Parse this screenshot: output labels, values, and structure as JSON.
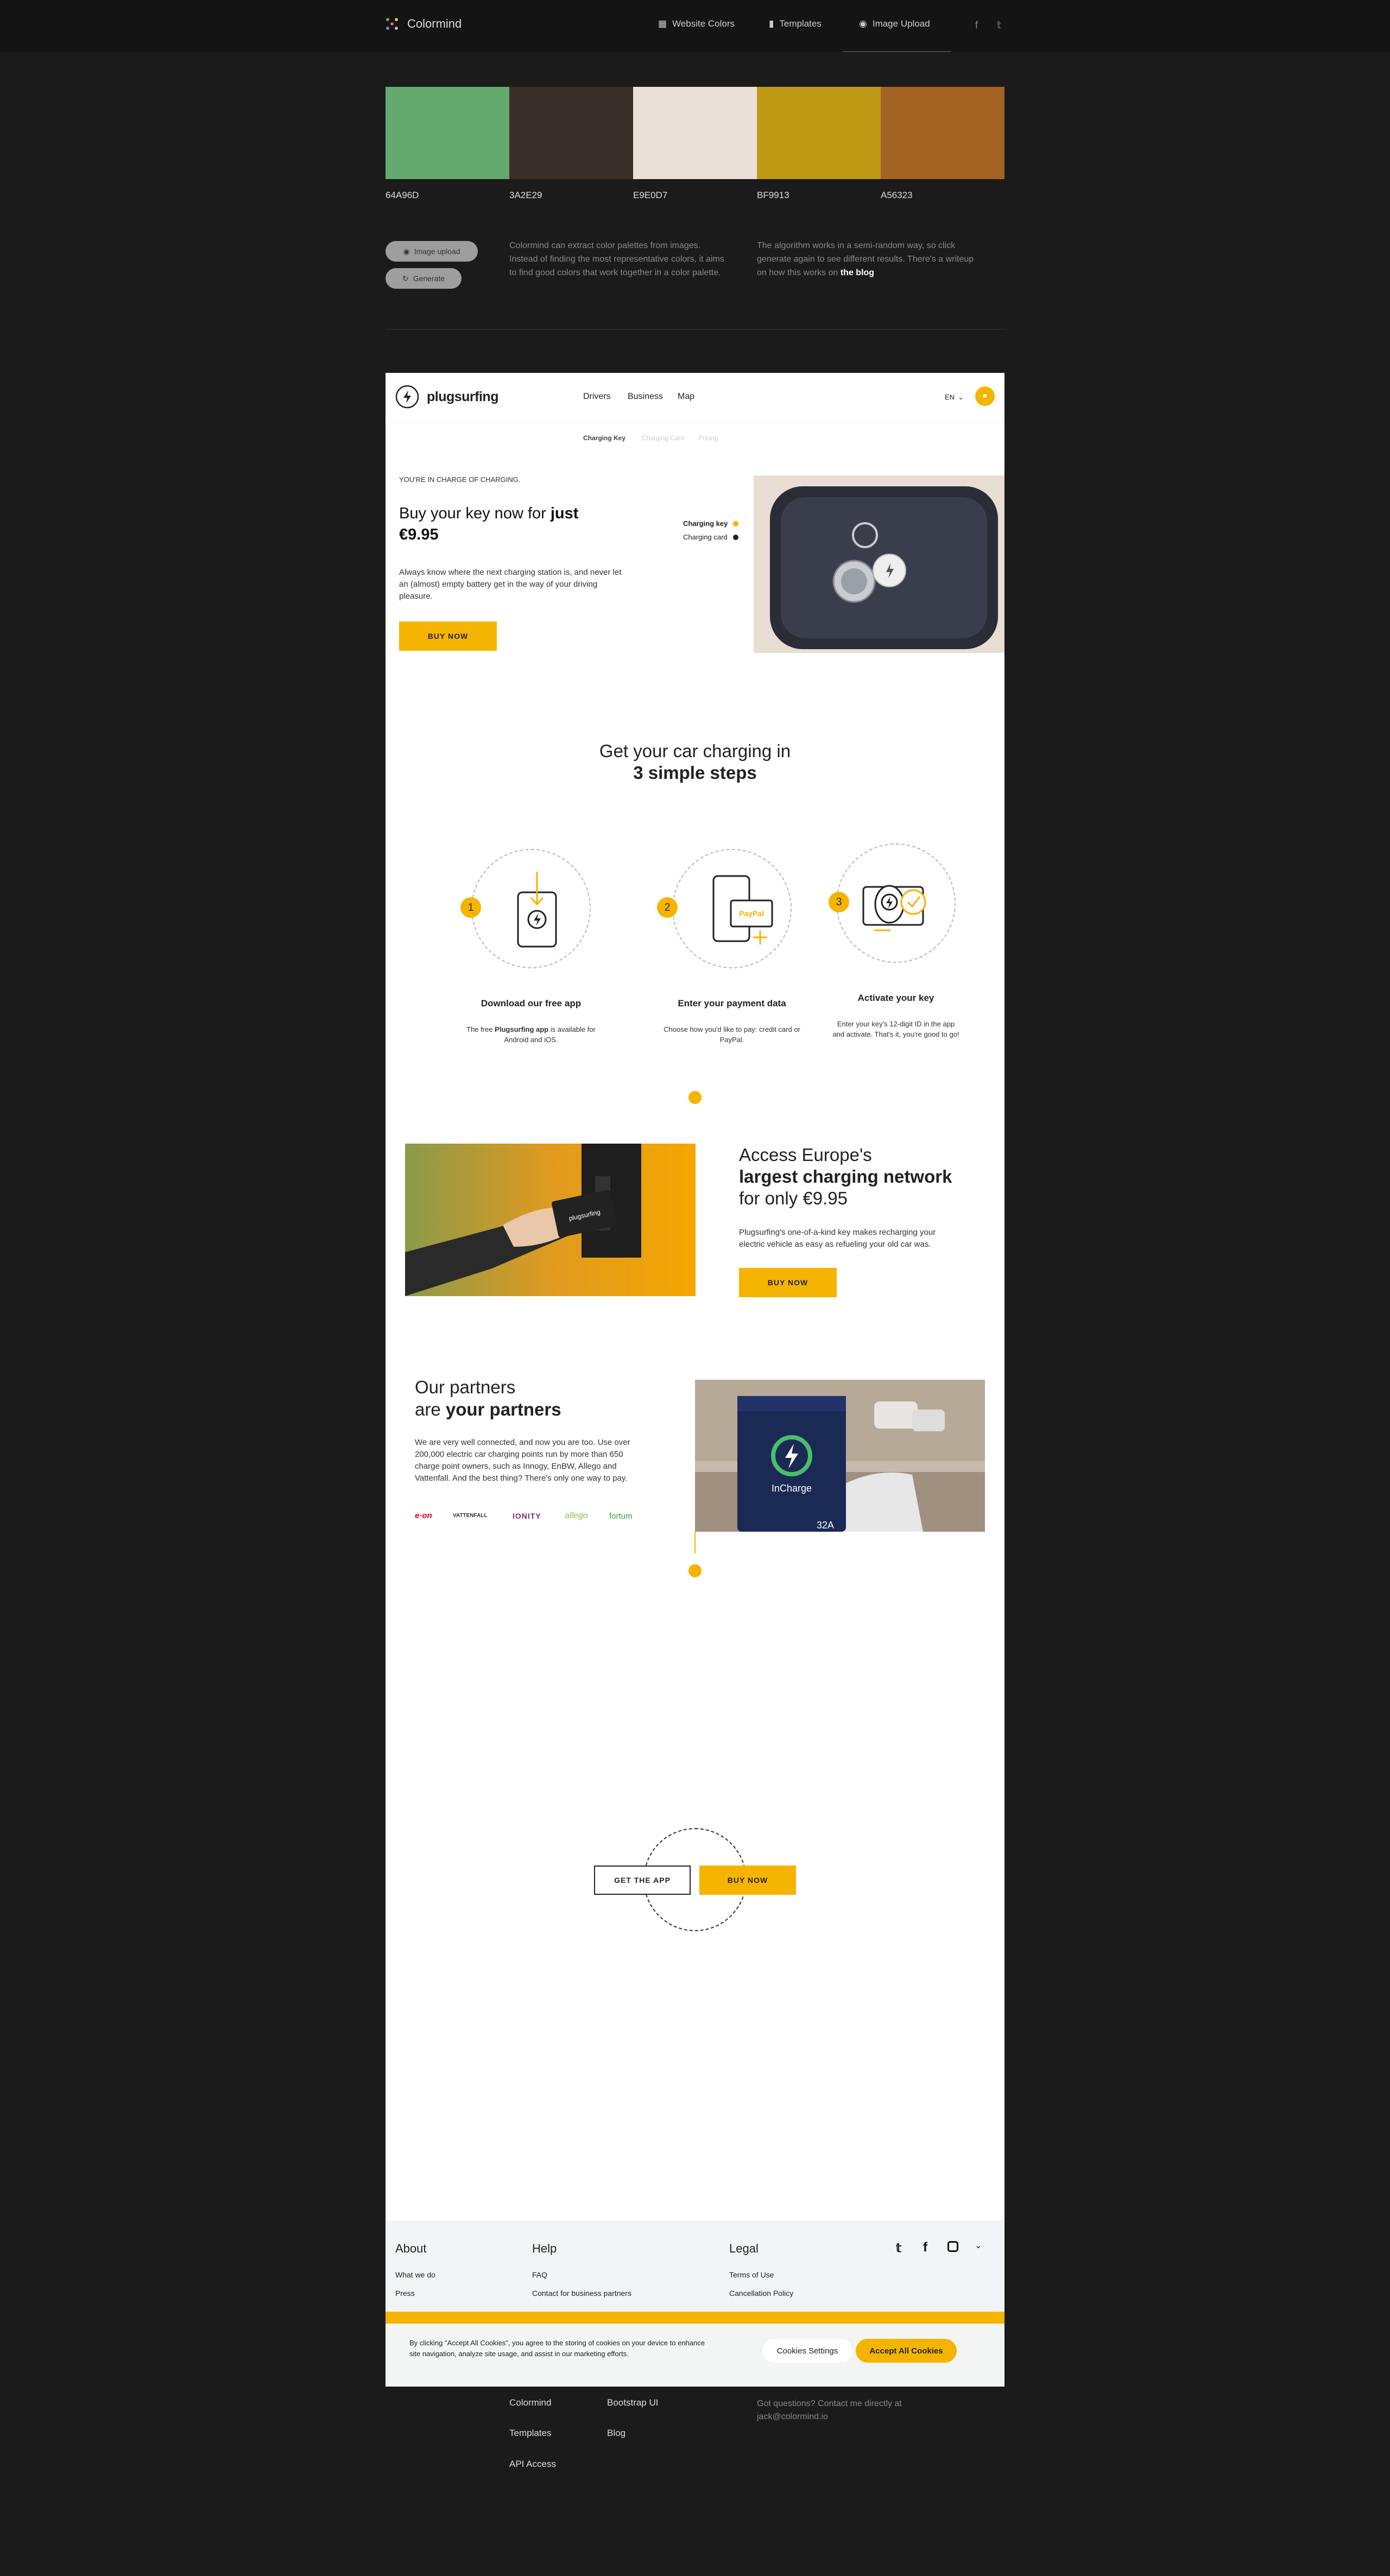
{
  "app": {
    "name": "Colormind"
  },
  "nav": {
    "website_colors": "Website Colors",
    "templates": "Templates",
    "image_upload": "Image Upload"
  },
  "palette": [
    {
      "hex": "64A96D",
      "color": "#64a96d"
    },
    {
      "hex": "3A2E29",
      "color": "#3a2e29"
    },
    {
      "hex": "E9E0D7",
      "color": "#e9e0d7"
    },
    {
      "hex": "BF9913",
      "color": "#bf9913"
    },
    {
      "hex": "A56323",
      "color": "#a56323"
    }
  ],
  "actions": {
    "image_upload": "Image upload",
    "generate": "Generate"
  },
  "about": {
    "text1": "Colormind can extract color palettes from images. Instead of finding the most representative colors, it aims to find good colors that work together in a color palette.",
    "text2_prefix": "The algorithm works in a semi-random way, so click generate again to see different results. There's a writeup on how this works on ",
    "text2_link": "the blog"
  },
  "preview": {
    "brand": "plugsurfing",
    "nav": [
      "Drivers",
      "Business",
      "Map"
    ],
    "lang": "EN",
    "subnav": [
      "Charging Key",
      "Charging Card",
      "Pricing"
    ],
    "hero": {
      "eyebrow": "YOU'RE IN CHARGE OF CHARGING.",
      "title_prefix": "Buy your key now for ",
      "title_bold": "just €9.95",
      "body": "Always know where the next charging station is, and never let an (almost) empty battery get in the way of your driving pleasure.",
      "cta": "BUY NOW",
      "opt1": "Charging key",
      "opt2": "Charging card"
    },
    "steps": {
      "title_line1": "Get your car charging in",
      "title_line2": "3 simple steps",
      "items": [
        {
          "num": "1",
          "title": "Download our free app",
          "text_pre": "The free ",
          "text_bold": "Plugsurfing app",
          "text_post": " is available for Android and iOS."
        },
        {
          "num": "2",
          "title": "Enter your payment data",
          "text_pre": "Choose how you'd like to pay: credit card or PayPal.",
          "text_bold": "",
          "text_post": ""
        },
        {
          "num": "3",
          "title": "Activate your key",
          "text_pre": "Enter your key's 12-digit ID in the app and activate. That's it, you're good to go!",
          "text_bold": "",
          "text_post": ""
        }
      ],
      "paypal": "PayPal"
    },
    "access": {
      "line1": "Access Europe's",
      "line2": "largest charging network",
      "line3": "for only €9.95",
      "body": "Plugsurfing's one-of-a-kind key makes recharging your electric vehicle as easy as refueling your old car was.",
      "cta": "BUY NOW",
      "card_label": "plugsurfing"
    },
    "partners": {
      "line1": "Our partners",
      "line2_prefix": "are ",
      "line2_bold": "your partners",
      "body": "We are very well connected, and now you are too. Use over 200,000 electric car charging points run by more than 650 charge point owners, such as Innogy, EnBW, Allego and Vattenfall. And the best thing? There's only one way to pay.",
      "logos": [
        "e·on",
        "VATTENFALL",
        "IONITY",
        "allego",
        "fortum"
      ],
      "photo_brand": "InCharge",
      "photo_amp": "32A"
    },
    "cta": {
      "get_app": "GET THE APP",
      "buy_now": "BUY NOW"
    },
    "footer": {
      "about": {
        "title": "About",
        "links": [
          "What we do",
          "Press"
        ]
      },
      "help": {
        "title": "Help",
        "links": [
          "FAQ",
          "Contact for business partners"
        ]
      },
      "legal": {
        "title": "Legal",
        "links": [
          "Terms of Use",
          "Cancellation Policy"
        ]
      }
    },
    "cookie": {
      "text": "By clicking \"Accept All Cookies\", you agree to the storing of cookies on your device to enhance site navigation, analyze site usage, and assist in our marketing efforts.",
      "settings": "Cookies Settings",
      "accept": "Accept All Cookies"
    }
  },
  "site_footer": {
    "col1": [
      "Colormind",
      "Templates",
      "API Access"
    ],
    "col2": [
      "Bootstrap UI",
      "Blog"
    ],
    "contact_line1": "Got questions? Contact me directly at",
    "contact_line2": "jack@colormind.io"
  }
}
